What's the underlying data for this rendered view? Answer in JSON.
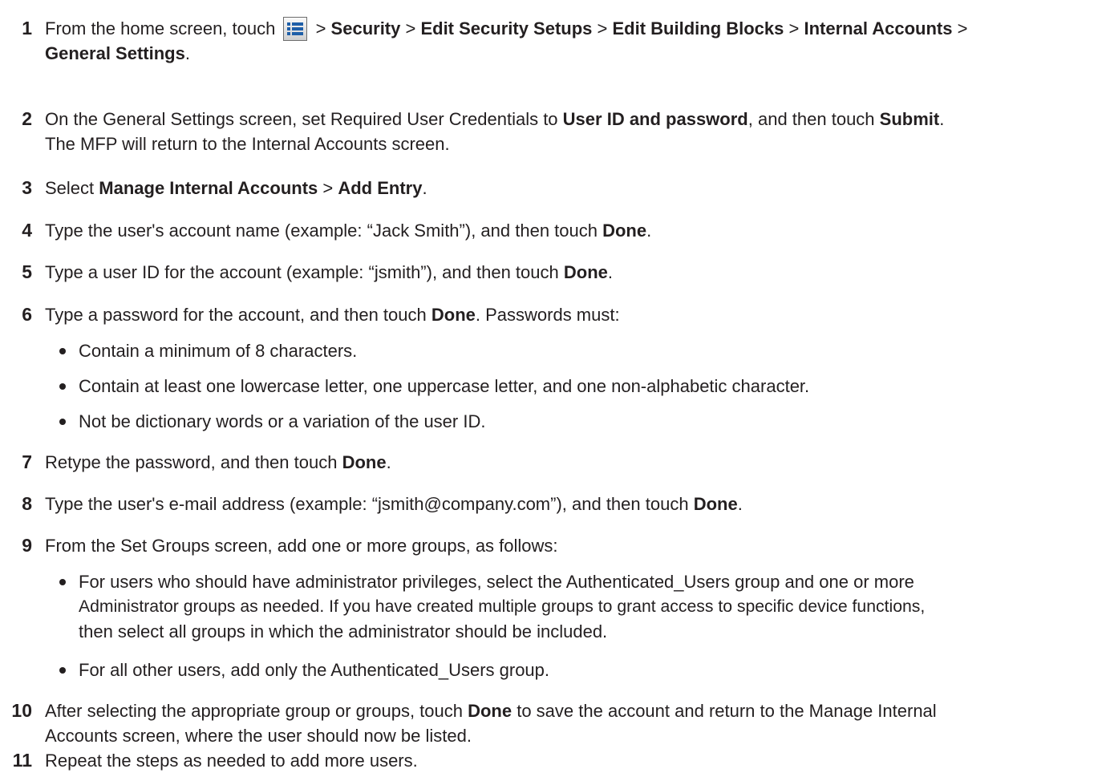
{
  "steps": [
    {
      "num": "1",
      "t1": "From the home screen, touch ",
      "icon": "menu-list-icon",
      "t2": " > ",
      "b1": "Security",
      "t3": " > ",
      "b2": "Edit Security Setups",
      "t4": " > ",
      "b3": "Edit Building Blocks",
      "t5": " > ",
      "b4": "Internal Accounts",
      "t6": " >",
      "b5": "General Settings",
      "t7": "."
    },
    {
      "num": "2",
      "t1": "On the General Settings screen, set Required User Credentials to ",
      "b1": "User ID and password",
      "t2": ", and then touch ",
      "b2": "Submit",
      "t3": ".",
      "t4": "The MFP will return to the Internal Accounts screen."
    },
    {
      "num": "3",
      "t1": "Select ",
      "b1": "Manage Internal Accounts",
      "t2": " > ",
      "b2": "Add Entry",
      "t3": "."
    },
    {
      "num": "4",
      "t1": "Type the user's account name (example: “Jack Smith”), and then touch ",
      "b1": "Done",
      "t2": "."
    },
    {
      "num": "5",
      "t1": "Type a user ID for the account (example: “jsmith”), and then touch ",
      "b1": "Done",
      "t2": "."
    },
    {
      "num": "6",
      "t1": "Type a password for the account, and then touch ",
      "b1": "Done",
      "t2": ". Passwords must:",
      "bullets": [
        "Contain a minimum of 8 characters.",
        "Contain at least one lowercase letter, one uppercase letter, and one non-alphabetic character.",
        "Not be dictionary words or a variation of the user ID."
      ]
    },
    {
      "num": "7",
      "t1": "Retype the password, and then touch ",
      "b1": "Done",
      "t2": "."
    },
    {
      "num": "8",
      "t1": "Type the user's e-mail address (example: “jsmith@company.com”), and then touch ",
      "b1": "Done",
      "t2": "."
    },
    {
      "num": "9",
      "t1": "From the Set Groups screen, add one or more groups, as follows:",
      "bullets": [
        "For users who should have administrator privileges, select the Authenticated_Users group and one or more",
        "Administrator groups as needed. If you have created multiple groups to grant access to specific device functions,",
        "then select all groups in which the administrator should be included.",
        "For all other users, add only the Authenticated_Users group."
      ]
    },
    {
      "num": "10",
      "t1": "After selecting the appropriate group or groups, touch ",
      "b1": "Done",
      "t2": " to save the account and return to the Manage Internal",
      "t3": "Accounts screen, where the user should now be listed."
    },
    {
      "num": "11",
      "t1": "Repeat the steps as needed to add more users."
    }
  ]
}
